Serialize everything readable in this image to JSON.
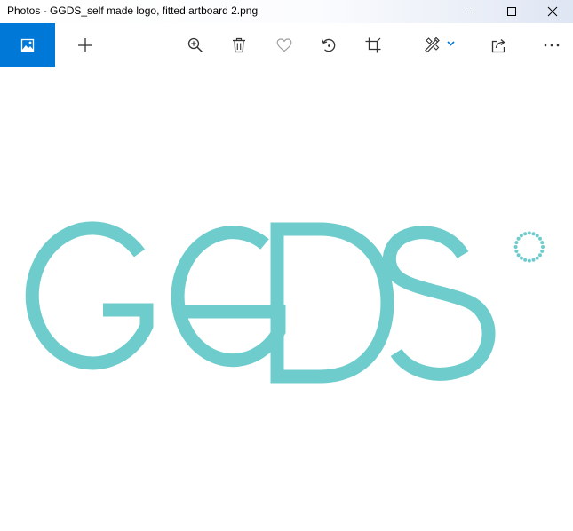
{
  "window": {
    "title": "Photos - GGDS_self made logo, fitted artboard 2.png",
    "controls": [
      "minimize",
      "maximize",
      "close"
    ]
  },
  "toolbar": {
    "accent_color": "#0078d7",
    "buttons": [
      {
        "name": "see-all-photos",
        "icon": "image-icon"
      },
      {
        "name": "add-to",
        "icon": "plus-icon"
      },
      {
        "name": "zoom",
        "icon": "zoom-in-icon"
      },
      {
        "name": "delete",
        "icon": "trash-icon"
      },
      {
        "name": "favorite",
        "icon": "heart-icon"
      },
      {
        "name": "rotate",
        "icon": "rotate-icon"
      },
      {
        "name": "crop",
        "icon": "crop-icon"
      },
      {
        "name": "edit-and-create",
        "icon": "edit-create-icon"
      },
      {
        "name": "share",
        "icon": "share-icon"
      },
      {
        "name": "see-more",
        "icon": "more-icon"
      }
    ]
  },
  "image": {
    "logo_letters": [
      "G",
      "G",
      "D",
      "S"
    ],
    "logo_color": "#6ecccd"
  }
}
